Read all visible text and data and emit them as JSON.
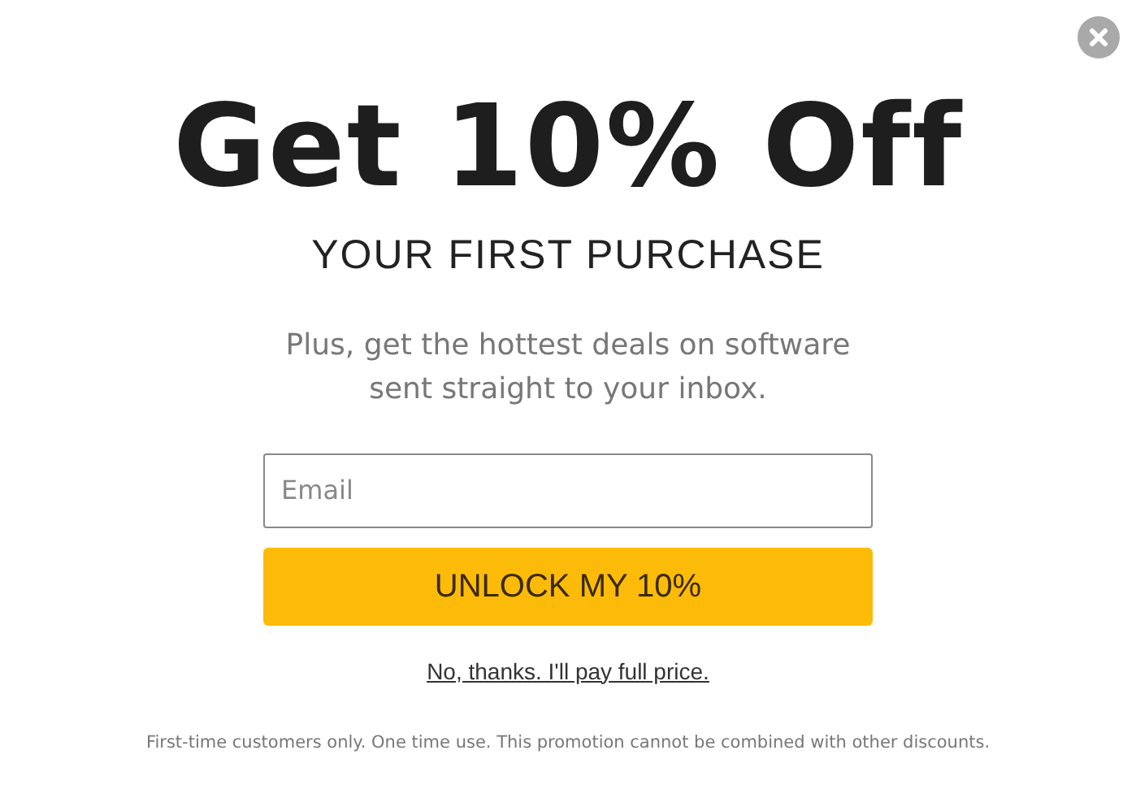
{
  "headline": "Get 10% Off",
  "subheadline": "YOUR FIRST PURCHASE",
  "description": "Plus, get the hottest deals on software sent straight to your inbox.",
  "email": {
    "placeholder": "Email"
  },
  "submit_button": "UNLOCK MY 10%",
  "decline_link": "No, thanks. I'll pay full price.",
  "disclaimer": "First-time customers only. One time use. This promotion cannot be combined with other discounts."
}
